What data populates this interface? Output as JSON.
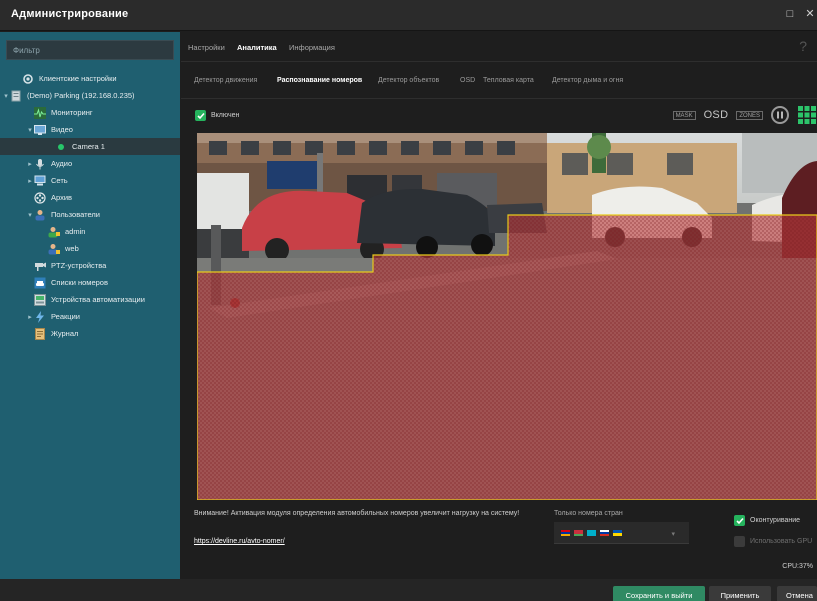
{
  "window": {
    "title": "Администрирование",
    "maximize_glyph": "□",
    "close_glyph": "✕"
  },
  "sidebar": {
    "filter_placeholder": "Фильтр",
    "items": [
      {
        "label": "Клиентские настройки"
      },
      {
        "label": "(Demo) Parking (192.168.0.235)"
      },
      {
        "label": "Мониторинг"
      },
      {
        "label": "Видео"
      },
      {
        "label": "Camera 1"
      },
      {
        "label": "Аудио"
      },
      {
        "label": "Сеть"
      },
      {
        "label": "Архив"
      },
      {
        "label": "Пользователи"
      },
      {
        "label": "admin"
      },
      {
        "label": "web"
      },
      {
        "label": "PTZ-устройства"
      },
      {
        "label": "Списки номеров"
      },
      {
        "label": "Устройства автоматизации"
      },
      {
        "label": "Реакции"
      },
      {
        "label": "Журнал"
      }
    ]
  },
  "tabs": {
    "settings": "Настройки",
    "analytics": "Аналитика",
    "info": "Информация",
    "help": "?"
  },
  "subtabs": {
    "motion": "Детектор движения",
    "plates": "Распознавание номеров",
    "objects": "Детектор объектов",
    "osd": "OSD",
    "heatmap": "Тепловая карта",
    "smoke": "Детектор дыма и огня"
  },
  "enabled_label": "Включен",
  "toolbar": {
    "badge1": "MASK",
    "osd": "OSD",
    "badge2": "ZONES"
  },
  "bottom": {
    "warning": "Внимание! Активация модуля определения автомобильных номеров увеличит нагрузку на систему!",
    "link": "https://devline.ru/avto-nomer/",
    "only_countries_label": "Только номера стран",
    "contouring_label": "Оконтуривание",
    "use_gpu_label": "Использовать GPU",
    "cpu": "CPU:37%"
  },
  "footer": {
    "save_exit": "Сохранить и выйти",
    "apply": "Применить",
    "cancel": "Отмена"
  },
  "colors": {
    "accent_green": "#25b35d",
    "sidebar": "#1f5f70",
    "zone_red": "#c0393b",
    "zone_border": "#e7c91c"
  }
}
